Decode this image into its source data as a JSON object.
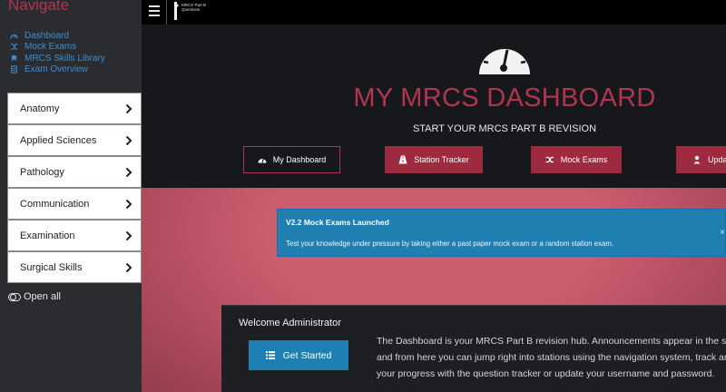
{
  "sidebar": {
    "title": "Navigate",
    "links": [
      {
        "label": "Dashboard",
        "icon": "gauge-icon"
      },
      {
        "label": "Mock Exams",
        "icon": "shuffle-icon"
      },
      {
        "label": "MRCS Skills Library",
        "icon": "tooth-icon"
      },
      {
        "label": "Exam Overview",
        "icon": "document-icon"
      }
    ],
    "sections": [
      {
        "label": "Anatomy"
      },
      {
        "label": "Applied Sciences"
      },
      {
        "label": "Pathology"
      },
      {
        "label": "Communication"
      },
      {
        "label": "Examination"
      },
      {
        "label": "Surgical Skills"
      }
    ],
    "open_all_label": "Open all"
  },
  "topbar": {
    "logo_text": "MRCS Part B Questions"
  },
  "hero": {
    "title": "MY MRCS DASHBOARD",
    "subtitle": "START YOUR MRCS PART B REVISION",
    "buttons": [
      {
        "label": "My Dashboard",
        "icon": "gauge-icon",
        "style": "outline"
      },
      {
        "label": "Station Tracker",
        "icon": "road-icon",
        "style": "filled"
      },
      {
        "label": "Mock Exams",
        "icon": "shuffle-icon",
        "style": "filled"
      },
      {
        "label": "Update",
        "icon": "user-icon",
        "style": "filled"
      }
    ]
  },
  "alert": {
    "title": "V2.2 Mock Exams Launched",
    "text": "Test your knowledge under pressure by taking either a past paper mock exam or a random station exam.",
    "close": "×"
  },
  "welcome": {
    "title": "Welcome Administrator",
    "button_label": "Get Started",
    "text_lines": [
      "The Dashboard is your MRCS Part B revision hub. Announcements appear in the space",
      "and from here you can jump right into stations using the navigation system, track and a",
      "your progress with the question tracker or update your username and password."
    ]
  },
  "colors": {
    "accent": "#b0364f",
    "button_fill": "#9e2a40",
    "link": "#3a8fd6",
    "alert": "#1f7fb0",
    "pink_bg": "#cc5d6f"
  }
}
